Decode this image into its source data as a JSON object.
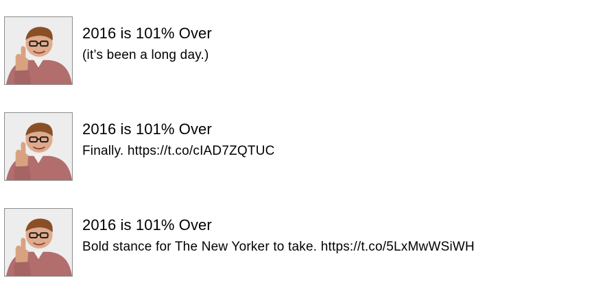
{
  "tweets": [
    {
      "title": "2016 is 101% Over",
      "text": "(it’s been a long day.)",
      "avatar_icon": "person-thumbs-up-photo"
    },
    {
      "title": "2016 is 101% Over",
      "text": "Finally. https://t.co/cIAD7ZQTUC",
      "avatar_icon": "person-thumbs-up-photo"
    },
    {
      "title": "2016 is 101% Over",
      "text": "Bold stance for The New Yorker to take. https://t.co/5LxMwWSiWH",
      "avatar_icon": "person-thumbs-up-photo"
    }
  ]
}
